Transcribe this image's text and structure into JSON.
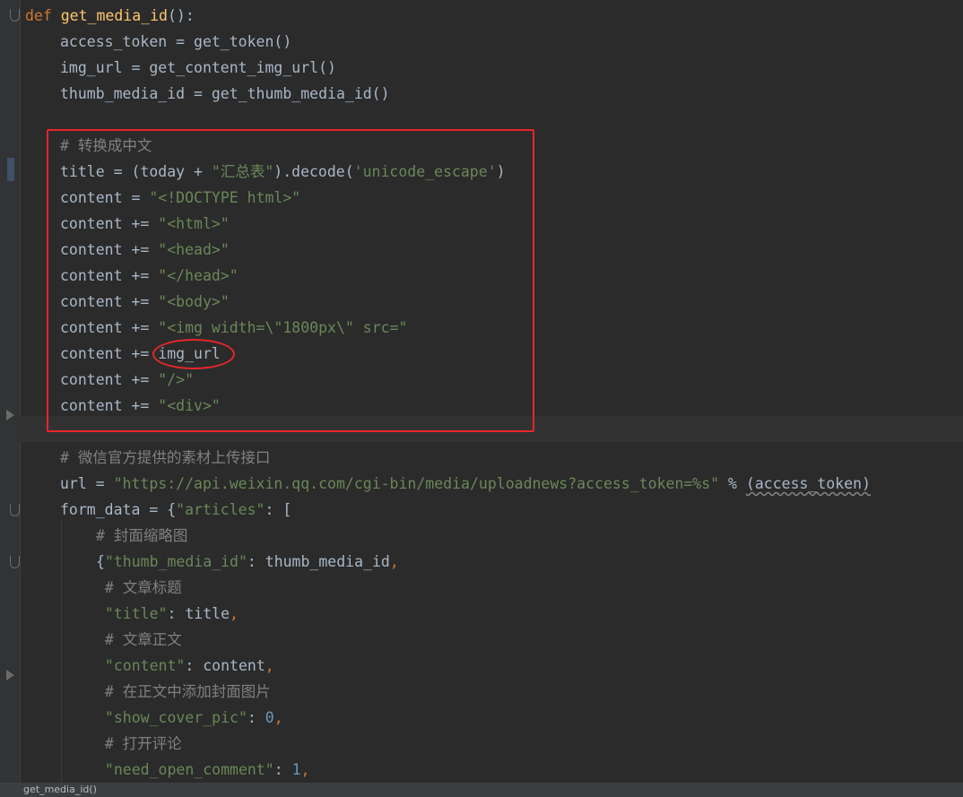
{
  "editor": {
    "lines": [
      {
        "indent": 0,
        "tokens": [
          {
            "c": "kw",
            "t": "def "
          },
          {
            "c": "fn",
            "t": "get_media_id"
          },
          {
            "c": "plain",
            "t": "():"
          }
        ]
      },
      {
        "indent": 1,
        "tokens": [
          {
            "c": "plain",
            "t": "access_token = get_token()"
          }
        ]
      },
      {
        "indent": 1,
        "tokens": [
          {
            "c": "plain",
            "t": "img_url = get_content_img_url()"
          }
        ]
      },
      {
        "indent": 1,
        "tokens": [
          {
            "c": "plain",
            "t": "thumb_media_id = get_thumb_media_id()"
          }
        ]
      },
      {
        "indent": 0,
        "tokens": []
      },
      {
        "indent": 1,
        "tokens": [
          {
            "c": "cmt",
            "t": "# 转换成中文"
          }
        ]
      },
      {
        "indent": 1,
        "tokens": [
          {
            "c": "plain",
            "t": "title = (today + "
          },
          {
            "c": "str",
            "t": "\"汇总表\""
          },
          {
            "c": "plain",
            "t": ").decode("
          },
          {
            "c": "str",
            "t": "'unicode_escape'"
          },
          {
            "c": "plain",
            "t": ")"
          }
        ]
      },
      {
        "indent": 1,
        "tokens": [
          {
            "c": "plain",
            "t": "content = "
          },
          {
            "c": "str",
            "t": "\"<!DOCTYPE html>\""
          }
        ]
      },
      {
        "indent": 1,
        "tokens": [
          {
            "c": "plain",
            "t": "content += "
          },
          {
            "c": "str",
            "t": "\"<html>\""
          }
        ]
      },
      {
        "indent": 1,
        "tokens": [
          {
            "c": "plain",
            "t": "content += "
          },
          {
            "c": "str",
            "t": "\"<head>\""
          }
        ]
      },
      {
        "indent": 1,
        "tokens": [
          {
            "c": "plain",
            "t": "content += "
          },
          {
            "c": "str",
            "t": "\"</head>\""
          }
        ]
      },
      {
        "indent": 1,
        "tokens": [
          {
            "c": "plain",
            "t": "content += "
          },
          {
            "c": "str",
            "t": "\"<body>\""
          }
        ]
      },
      {
        "indent": 1,
        "tokens": [
          {
            "c": "plain",
            "t": "content += "
          },
          {
            "c": "str",
            "t": "\"<img width=\\\"1800px\\\" src=\""
          }
        ]
      },
      {
        "indent": 1,
        "tokens": [
          {
            "c": "plain",
            "t": "content += img_url"
          }
        ]
      },
      {
        "indent": 1,
        "tokens": [
          {
            "c": "plain",
            "t": "content += "
          },
          {
            "c": "str",
            "t": "\"/>\""
          }
        ]
      },
      {
        "indent": 1,
        "tokens": [
          {
            "c": "plain",
            "t": "content += "
          },
          {
            "c": "str",
            "t": "\"<div>\""
          }
        ]
      },
      {
        "indent": 0,
        "tokens": []
      },
      {
        "indent": 1,
        "tokens": [
          {
            "c": "cmt",
            "t": "# 微信官方提供的素材上传接口"
          }
        ]
      },
      {
        "indent": 1,
        "tokens": [
          {
            "c": "plain",
            "t": "url = "
          },
          {
            "c": "str",
            "t": "\"https://api.weixin.qq.com/cgi-bin/media/uploadnews?access_token=%s\""
          },
          {
            "c": "plain",
            "t": " % "
          },
          {
            "c": "underline",
            "t": "(access_token)"
          }
        ]
      },
      {
        "indent": 1,
        "tokens": [
          {
            "c": "plain",
            "t": "form_data = {"
          },
          {
            "c": "str",
            "t": "\"articles\""
          },
          {
            "c": "plain",
            "t": ": ["
          }
        ]
      },
      {
        "indent": 2,
        "tokens": [
          {
            "c": "cmt",
            "t": "# 封面缩略图"
          }
        ]
      },
      {
        "indent": 2,
        "tokens": [
          {
            "c": "plain",
            "t": "{"
          },
          {
            "c": "str",
            "t": "\"thumb_media_id\""
          },
          {
            "c": "plain",
            "t": ": thumb_media_id"
          },
          {
            "c": "kw",
            "t": ","
          }
        ]
      },
      {
        "indent": 2,
        "tokens": [
          {
            "c": "cmt",
            "t": " # 文章标题"
          }
        ]
      },
      {
        "indent": 2,
        "tokens": [
          {
            "c": "str",
            "t": " \"title\""
          },
          {
            "c": "plain",
            "t": ": title"
          },
          {
            "c": "kw",
            "t": ","
          }
        ]
      },
      {
        "indent": 2,
        "tokens": [
          {
            "c": "cmt",
            "t": " # 文章正文"
          }
        ]
      },
      {
        "indent": 2,
        "tokens": [
          {
            "c": "str",
            "t": " \"content\""
          },
          {
            "c": "plain",
            "t": ": content"
          },
          {
            "c": "kw",
            "t": ","
          }
        ]
      },
      {
        "indent": 2,
        "tokens": [
          {
            "c": "cmt",
            "t": " # 在正文中添加封面图片"
          }
        ]
      },
      {
        "indent": 2,
        "tokens": [
          {
            "c": "str",
            "t": " \"show_cover_pic\""
          },
          {
            "c": "plain",
            "t": ": "
          },
          {
            "c": "num",
            "t": "0"
          },
          {
            "c": "kw",
            "t": ","
          }
        ]
      },
      {
        "indent": 2,
        "tokens": [
          {
            "c": "cmt",
            "t": " # 打开评论"
          }
        ]
      },
      {
        "indent": 2,
        "tokens": [
          {
            "c": "str",
            "t": " \"need_open_comment\""
          },
          {
            "c": "plain",
            "t": ": "
          },
          {
            "c": "num",
            "t": "1"
          },
          {
            "c": "kw",
            "t": ","
          }
        ]
      }
    ]
  },
  "status_bar": {
    "breadcrumb": "get_media_id()"
  },
  "colors": {
    "annotation": "#e8262b",
    "background": "#2b2b2b"
  }
}
